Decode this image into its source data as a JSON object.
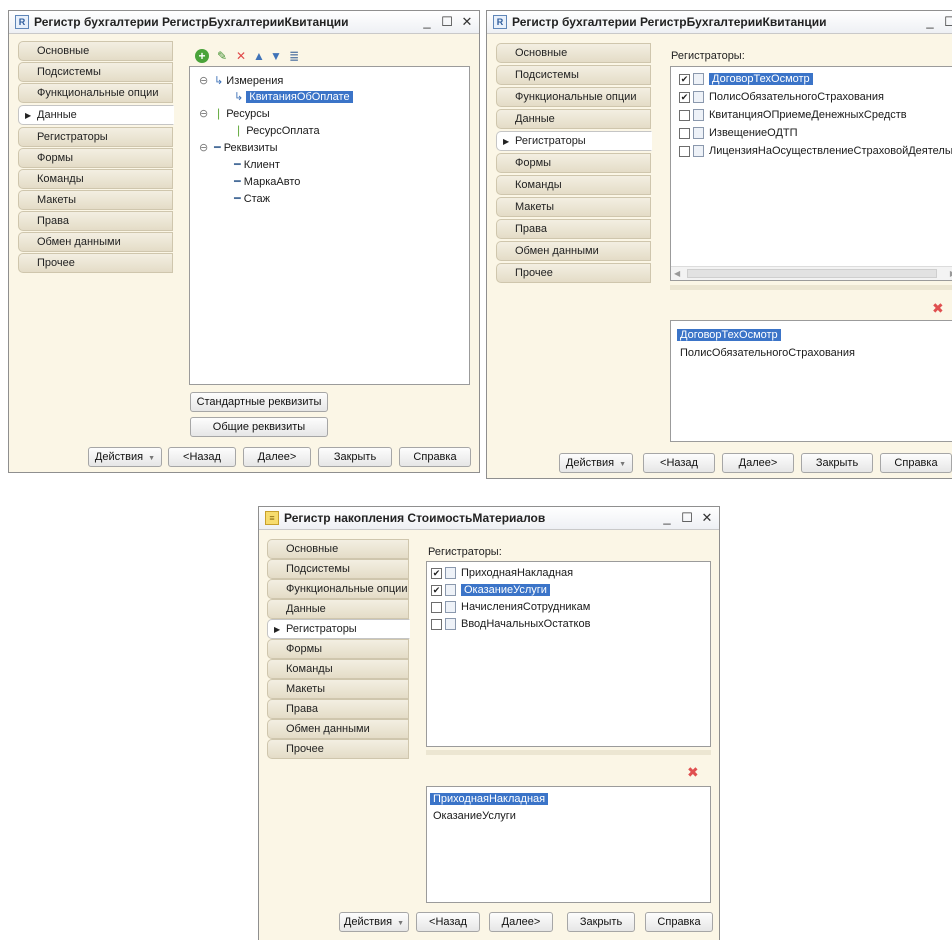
{
  "tabs": [
    "Основные",
    "Подсистемы",
    "Функциональные опции",
    "Данные",
    "Регистраторы",
    "Формы",
    "Команды",
    "Макеты",
    "Права",
    "Обмен данными",
    "Прочее"
  ],
  "win_controls": {
    "minimize": "_",
    "maximize": "☐",
    "close": "✕"
  },
  "buttons": {
    "actions": "Действия",
    "back": "<Назад",
    "next": "Далее>",
    "close": "Закрыть",
    "help": "Справка"
  },
  "win1": {
    "title": "Регистр бухгалтерии РегистрБухгалтерииКвитанции",
    "tree": {
      "dimensions": {
        "label": "Измерения",
        "items": [
          "КвитанияОбОплате"
        ]
      },
      "resources": {
        "label": "Ресурсы",
        "items": [
          "РесурсОплата"
        ]
      },
      "attributes": {
        "label": "Реквизиты",
        "items": [
          "Клиент",
          "МаркаАвто",
          "Стаж"
        ]
      }
    },
    "standard_attributes_button": "Стандартные реквизиты",
    "common_attributes_button": "Общие реквизиты"
  },
  "win2": {
    "title": "Регистр бухгалтерии РегистрБухгалтерииКвитанции",
    "registrators_label": "Регистраторы:",
    "registrators": [
      {
        "name": "ДоговорТехОсмотр",
        "checked": true,
        "selected": true
      },
      {
        "name": "ПолисОбязательногоСтрахования",
        "checked": true,
        "selected": false
      },
      {
        "name": "КвитанцияОПриемеДенежныхСредств",
        "checked": false,
        "selected": false
      },
      {
        "name": "ИзвещениеОДТП",
        "checked": false,
        "selected": false
      },
      {
        "name": "ЛицензияНаОсуществлениеСтраховойДеятельн",
        "checked": false,
        "selected": false
      }
    ],
    "selected_list": [
      "ДоговорТехОсмотр",
      "ПолисОбязательногоСтрахования"
    ]
  },
  "win3": {
    "title": "Регистр накопления СтоимостьМатериалов",
    "registrators_label": "Регистраторы:",
    "registrators": [
      {
        "name": "ПриходнаяНакладная",
        "checked": true,
        "selected": false
      },
      {
        "name": "ОказаниеУслуги",
        "checked": true,
        "selected": true
      },
      {
        "name": "НачисленияСотрудникам",
        "checked": false,
        "selected": false
      },
      {
        "name": "ВводНачальныхОстатков",
        "checked": false,
        "selected": false
      }
    ],
    "selected_list": [
      "ПриходнаяНакладная",
      "ОказаниеУслуги"
    ]
  }
}
